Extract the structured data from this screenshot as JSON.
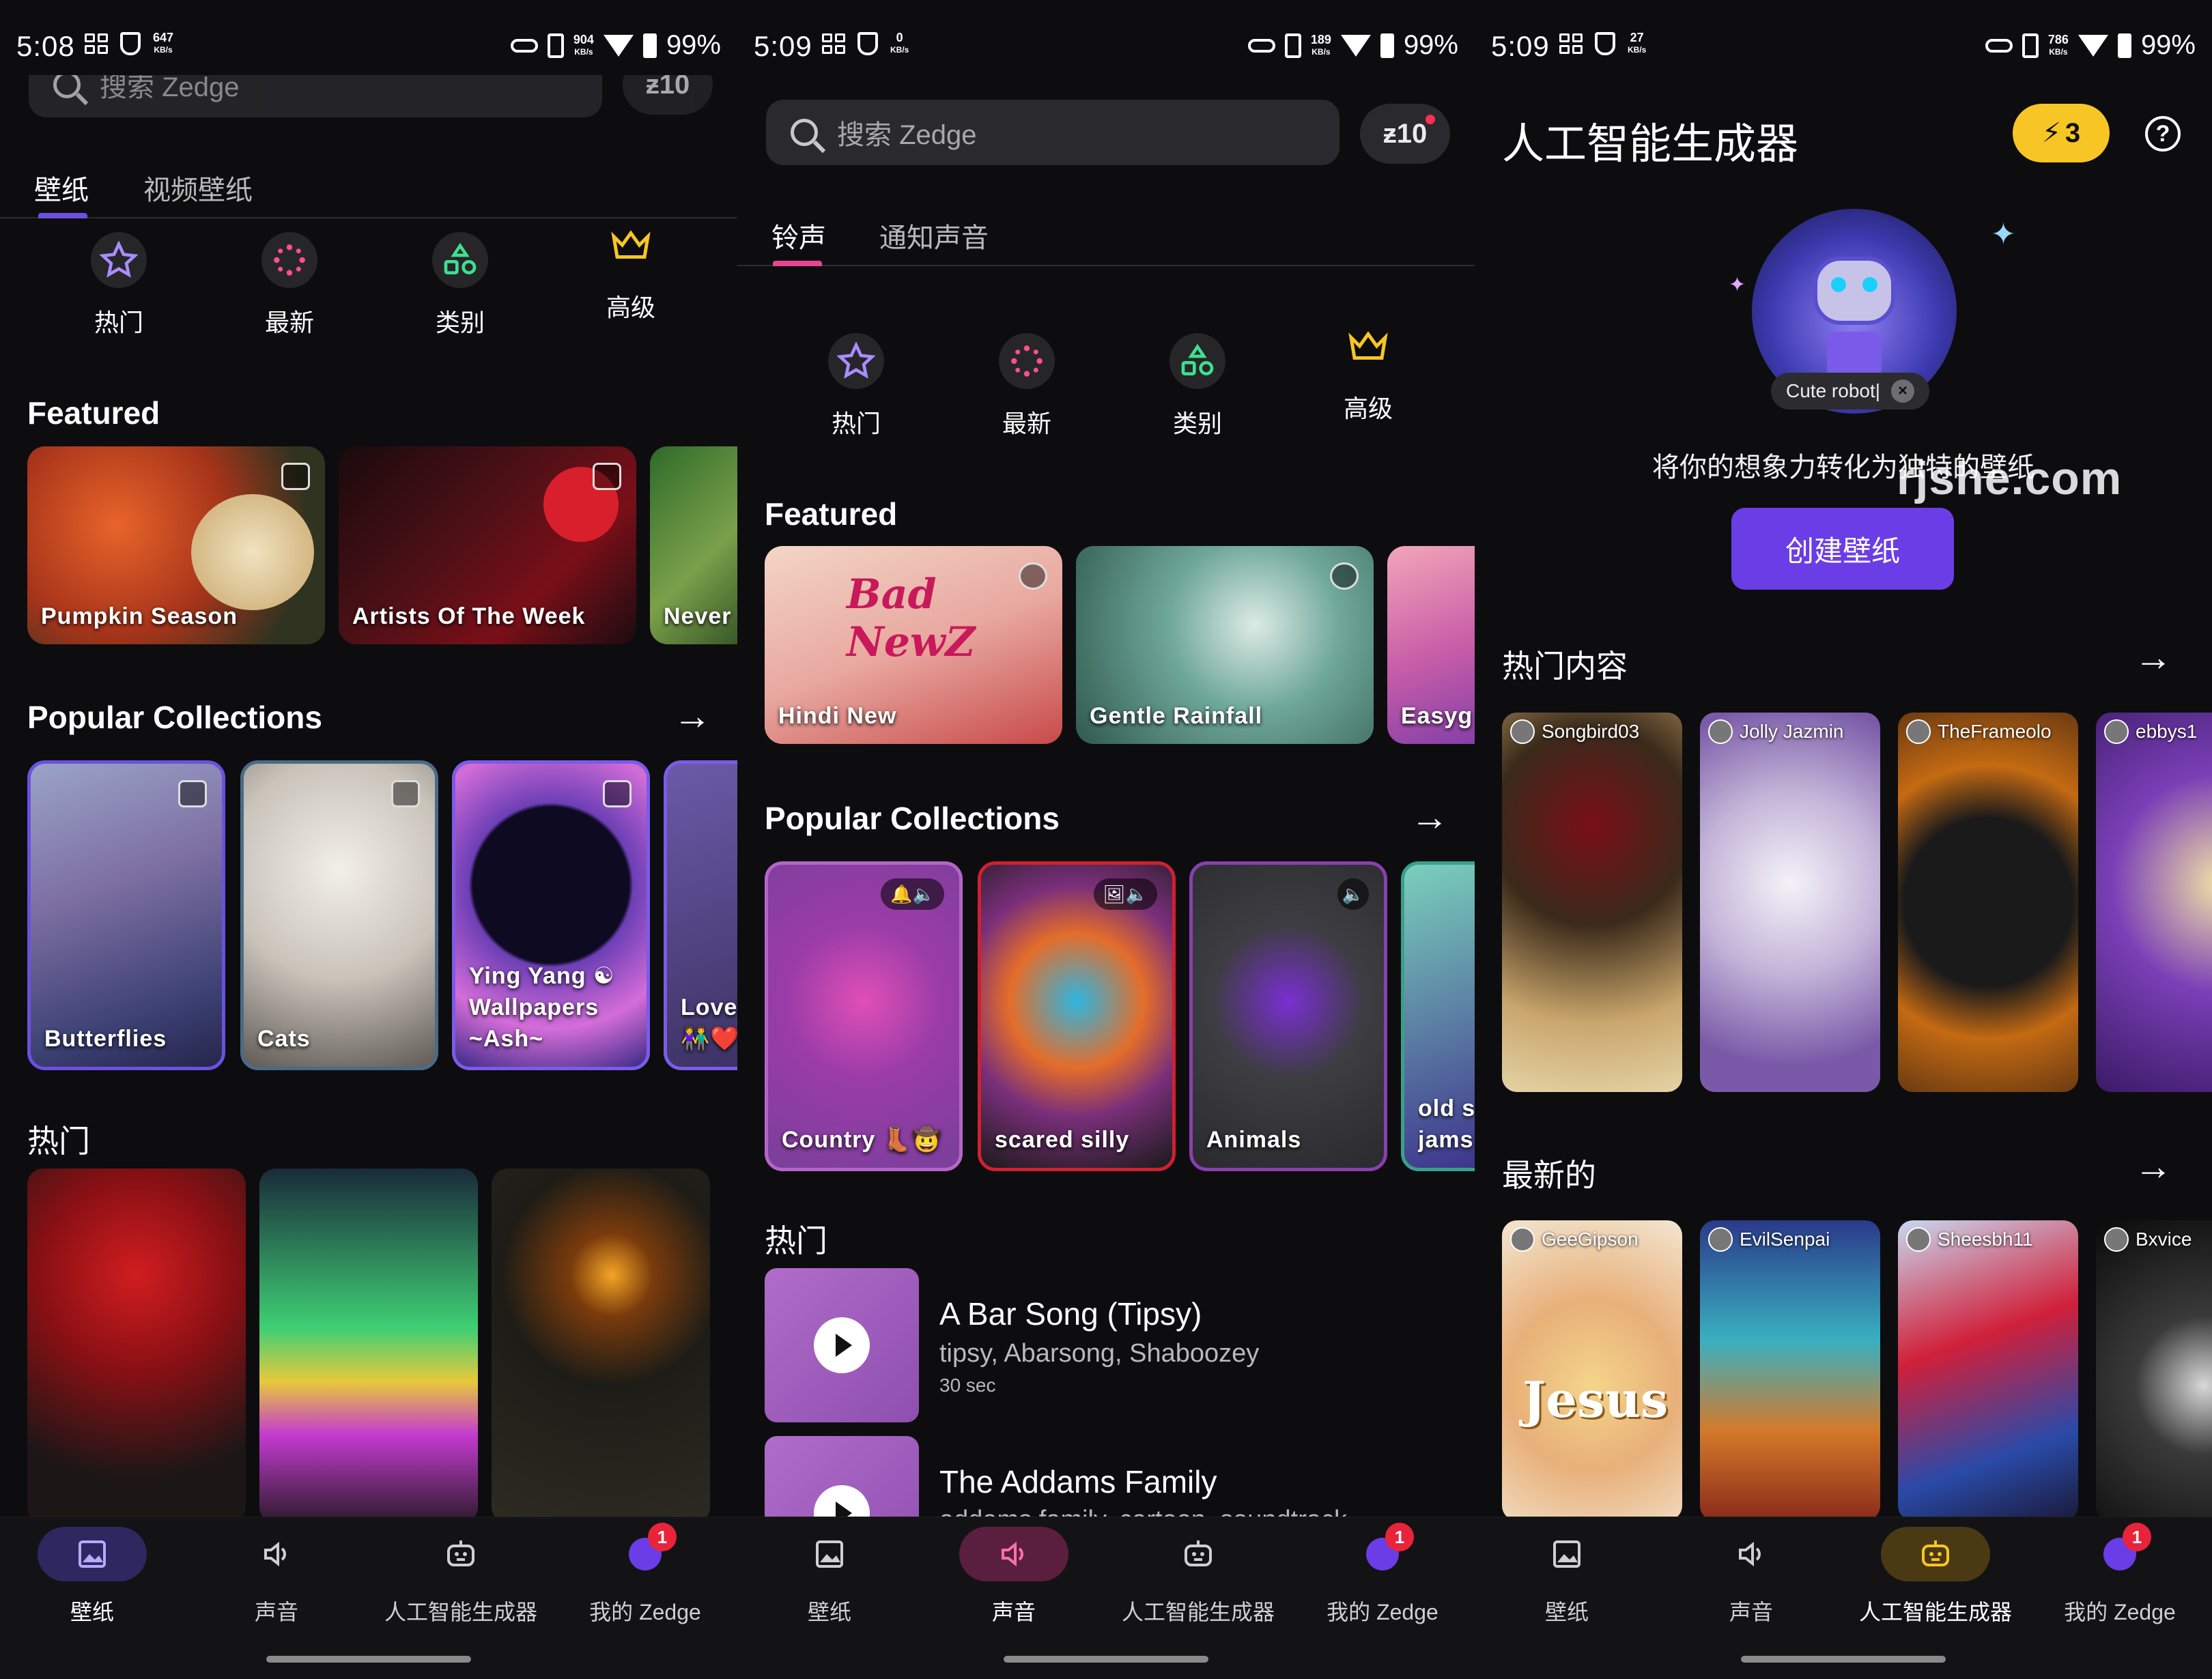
{
  "panels": [
    {
      "status": {
        "time": "5:08",
        "kbs": "647",
        "kbs_unit": "KB/s",
        "net": "904",
        "net_unit": "KB/s",
        "battery": "99%"
      },
      "search": {
        "placeholder": "搜索 Zedge",
        "coins": "ƶ10"
      },
      "tabs": [
        "壁纸",
        "视频壁纸"
      ],
      "categories": [
        "热门",
        "最新",
        "类别",
        "高级"
      ],
      "featured_title": "Featured",
      "featured": [
        "Pumpkin Season",
        "Artists Of The Week",
        "Never"
      ],
      "popular_title": "Popular Collections",
      "collections": [
        "Butterflies",
        "Cats",
        "Ying Yang ☯ Wallpapers ~Ash~",
        "Lovel 👫❤️"
      ],
      "hot_title": "热门",
      "nav": [
        "壁纸",
        "声音",
        "人工智能生成器",
        "我的 Zedge"
      ],
      "nav_badge": "1"
    },
    {
      "status": {
        "time": "5:09",
        "kbs": "0",
        "kbs_unit": "KB/s",
        "net": "189",
        "net_unit": "KB/s",
        "battery": "99%"
      },
      "search": {
        "placeholder": "搜索 Zedge",
        "coins": "ƶ10"
      },
      "tabs": [
        "铃声",
        "通知声音"
      ],
      "categories": [
        "热门",
        "最新",
        "类别",
        "高级"
      ],
      "featured_title": "Featured",
      "featured": [
        "Hindi New",
        "Gentle Rainfall",
        "Easyg"
      ],
      "featured_art_text": "Bad NewZ",
      "popular_title": "Popular Collections",
      "collections": [
        "Country 👢🤠",
        "scared silly",
        "Animals",
        "old s jams"
      ],
      "hot_title": "热门",
      "songs": [
        {
          "title": "A Bar Song (Tipsy)",
          "artist": "tipsy, Abarsong, Shaboozey",
          "duration": "30 sec"
        },
        {
          "title": "The Addams Family",
          "artist": "addams family, cartoon, soundtrack",
          "duration": ""
        }
      ],
      "nav": [
        "壁纸",
        "声音",
        "人工智能生成器",
        "我的 Zedge"
      ],
      "nav_badge": "1"
    },
    {
      "status": {
        "time": "5:09",
        "kbs": "27",
        "kbs_unit": "KB/s",
        "net": "786",
        "net_unit": "KB/s",
        "battery": "99%"
      },
      "title": "人工智能生成器",
      "credits": "3",
      "help": "?",
      "prompt_chip": "Cute robot|",
      "subtitle": "将你的想象力转化为独特的壁纸",
      "watermark": "rjshe.com",
      "create_label": "创建壁纸",
      "hot_title": "热门内容",
      "hot_users": [
        "Songbird03",
        "Jolly Jazmin",
        "TheFrameolo",
        "ebbys1"
      ],
      "latest_title": "最新的",
      "latest_users": [
        "GeeGipson",
        "EvilSenpai",
        "Sheesbh11",
        "Bxvice"
      ],
      "jesus_text": "Jesus",
      "nav": [
        "壁纸",
        "声音",
        "人工智能生成器",
        "我的 Zedge"
      ],
      "nav_badge": "1"
    }
  ],
  "colors": {
    "accent_purple": "#6b3de6",
    "wallpaper_tab": "#6a51e0",
    "sound_tab": "#e8458f",
    "ai_tab": "#f7c624",
    "badge": "#e8243a"
  }
}
